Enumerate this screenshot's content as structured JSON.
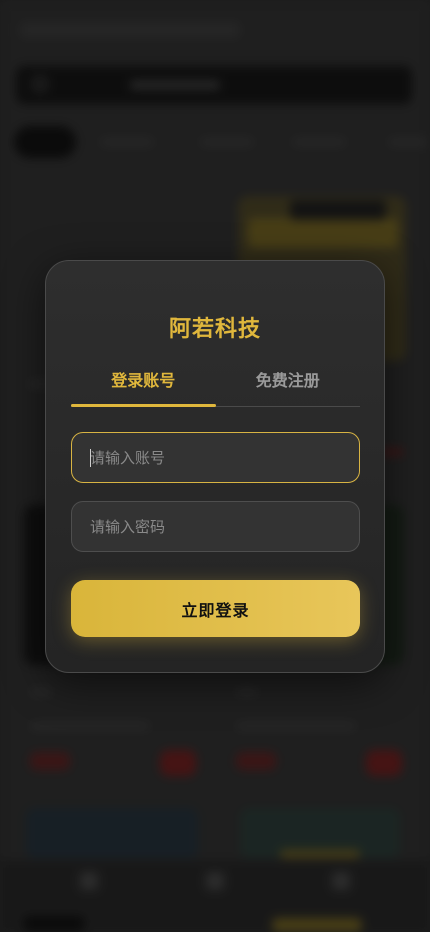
{
  "modal": {
    "title": "阿若科技",
    "tabs": [
      {
        "label": "登录账号",
        "active": true
      },
      {
        "label": "免费注册",
        "active": false
      }
    ],
    "account_field": {
      "placeholder": "请输入账号",
      "value": ""
    },
    "password_field": {
      "placeholder": "请输入密码",
      "value": ""
    },
    "submit_label": "立即登录"
  },
  "colors": {
    "accent": "#e0b73c",
    "modal_bg": "#2a2a2a",
    "backdrop": "#2b2b2b"
  }
}
